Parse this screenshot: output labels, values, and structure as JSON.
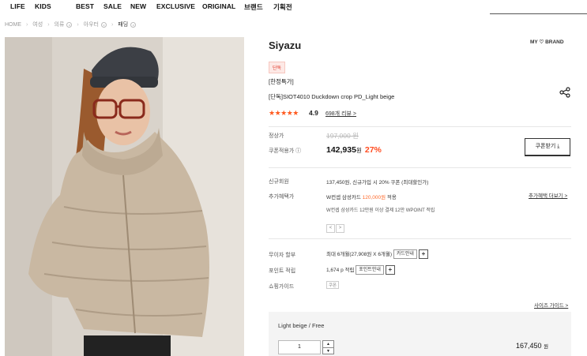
{
  "nav": {
    "items": [
      "LIFE",
      "KIDS",
      "BEST",
      "SALE",
      "NEW",
      "EXCLUSIVE",
      "ORIGINAL",
      "브랜드",
      "기획전"
    ]
  },
  "breadcrumb": {
    "home": "HOME",
    "items": [
      "여성",
      "의류",
      "아우터",
      "패딩"
    ]
  },
  "product": {
    "brand": "Siyazu",
    "my_brand": "MY ♡ BRAND",
    "badge": "단독",
    "promo": "[한정특가]",
    "name": "[단독]SIOT4010 Duckdown crop PD_Light beige",
    "stars": "★★★★★",
    "rating": "4.9",
    "reviews": "698개 리뷰 >"
  },
  "price": {
    "regular_label": "정상가",
    "regular": "197,000 원",
    "coupon_label": "쿠폰적용가 ⓘ",
    "sale": "142,935",
    "won": "원",
    "discount": "27%",
    "coupon_button": "쿠폰받기 ⤓"
  },
  "benefits": {
    "member_label": "신규회원",
    "member_text": "137,450원, 신규가입 시 20% 쿠폰 (최대할인가)",
    "extra_label": "추가혜택가",
    "extra_text_a": "W컨셉 삼성카드 ",
    "extra_price": "120,000원",
    "extra_text_b": " 적용",
    "extra_sub": "W컨셉 삼성카드 12만원 이상 결제 12만 WPOINT 적립",
    "more_link": "추가혜택 더보기 >",
    "prev": "<",
    "next": ">"
  },
  "info": {
    "installment_label": "무이자 할부",
    "installment_text": "최대 6개월(27,908원 X 6개월)",
    "installment_btn": "카드안내",
    "point_label": "포인트 적립",
    "point_text": "1,674 p 적립",
    "point_btn": "포인트안내",
    "plus": "+",
    "guide_label": "쇼핑가이드",
    "guide_tag": "쿠폰",
    "size_link": "사이즈 가이드 >"
  },
  "option": {
    "name": "Light beige / Free",
    "qty": "1",
    "up": "▲",
    "down": "▼",
    "price": "167,450",
    "won": "원"
  }
}
